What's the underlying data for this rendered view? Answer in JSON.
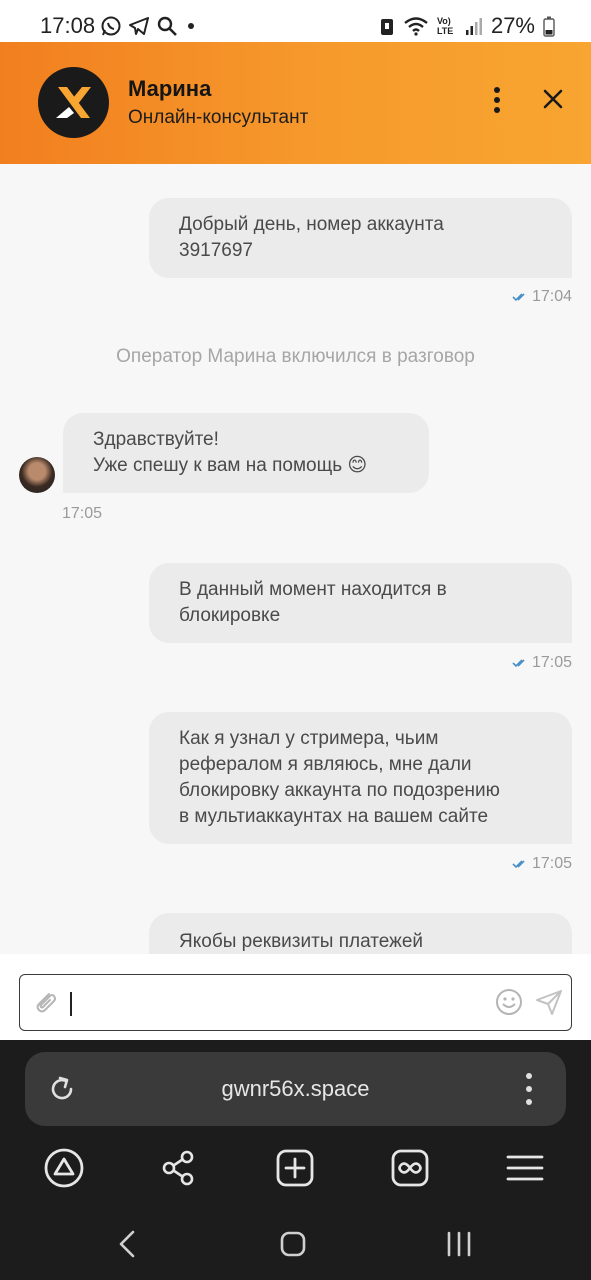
{
  "status_bar": {
    "time": "17:08",
    "battery": "27%",
    "network": "Vo) LTE"
  },
  "header": {
    "name": "Марина",
    "role": "Онлайн-консультант",
    "brand_color": "#f58f26"
  },
  "chat": {
    "system_message": "Оператор Марина включился в разговор",
    "messages": [
      {
        "direction": "out",
        "lines": [
          "Добрый день, номер аккаунта",
          "3917697"
        ],
        "time": "17:04"
      },
      {
        "direction": "in",
        "lines": [
          "Здравствуйте!",
          "Уже спешу к вам на помощь 😊"
        ],
        "time": "17:05"
      },
      {
        "direction": "out",
        "lines": [
          "В данный момент находится в",
          "блокировке"
        ],
        "time": "17:05"
      },
      {
        "direction": "out",
        "lines": [
          "Как я узнал у стримера, чьим",
          "рефералом я являюсь, мне дали",
          "блокировку аккаунта по подозрению",
          "в мультиаккаунтах на вашем сайте"
        ],
        "time": "17:05"
      },
      {
        "direction": "out",
        "lines": [
          "Якобы реквизиты платежей"
        ],
        "time": ""
      }
    ]
  },
  "input": {
    "value": "",
    "icons": [
      "paperclip-icon",
      "emoji-icon",
      "send-icon"
    ]
  },
  "browser": {
    "url": "gwnr56x.space",
    "nav_icons": [
      "home-icon",
      "share-icon",
      "new-tab-icon",
      "infinity-icon",
      "menu-icon"
    ]
  }
}
